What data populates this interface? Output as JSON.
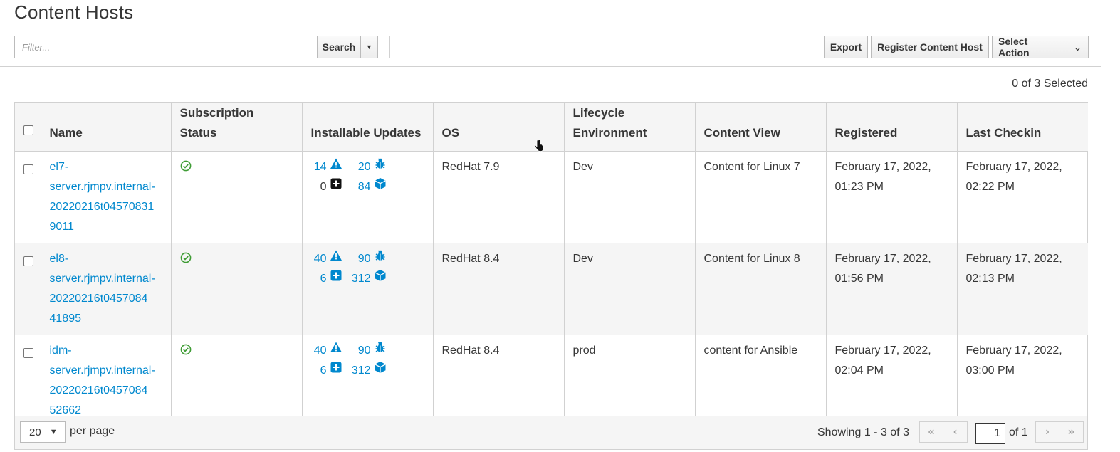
{
  "page": {
    "title": "Content Hosts"
  },
  "toolbar": {
    "filter_placeholder": "Filter...",
    "search_label": "Search",
    "export_label": "Export",
    "register_label": "Register Content Host",
    "select_action_label": "Select Action"
  },
  "selection": {
    "summary": "0 of 3 Selected"
  },
  "table": {
    "columns": [
      "Name",
      "Subscription Status",
      "Installable Updates",
      "OS",
      "Lifecycle Environment",
      "Content View",
      "Registered",
      "Last Checkin"
    ],
    "rows": [
      {
        "name": "el7-server.rjmpv.internal-20220216t045708319011",
        "name_lines": [
          "el7-",
          "server.rjmpv.internal-",
          "20220216t04570831",
          "9011"
        ],
        "subscription_status": "check-circle-icon",
        "security": "14",
        "bugfix": "20",
        "enhancement": "0",
        "packages": "84",
        "os": "RedHat 7.9",
        "lifecycle": "Dev",
        "content_view": "Content for Linux 7",
        "registered": [
          "February 17, 2022,",
          "01:23 PM"
        ],
        "last_checkin": [
          "February 17, 2022,",
          "02:22 PM"
        ]
      },
      {
        "name": "el8-server.rjmpv.internal-2022021 6t045708441895",
        "name_lines": [
          "el8-",
          "server.rjmpv.internal-",
          "20220216t0457084",
          "41895"
        ],
        "subscription_status": "check-circle-icon",
        "security": "40",
        "bugfix": "90",
        "enhancement": "6",
        "packages": "312",
        "os": "RedHat 8.4",
        "lifecycle": "Dev",
        "content_view": "Content for Linux 8",
        "registered": [
          "February 17, 2022,",
          "01:56 PM"
        ],
        "last_checkin": [
          "February 17, 2022,",
          "02:13 PM"
        ]
      },
      {
        "name": "idm-server.rjmpv.internal-20220216t045708452662",
        "name_lines": [
          "idm-",
          "server.rjmpv.internal-",
          "20220216t0457084",
          "52662"
        ],
        "subscription_status": "check-circle-icon",
        "security": "40",
        "bugfix": "90",
        "enhancement": "6",
        "packages": "312",
        "os": "RedHat 8.4",
        "lifecycle": "prod",
        "content_view": "content for Ansible",
        "registered": [
          "February 17, 2022,",
          "02:04 PM"
        ],
        "last_checkin": [
          "February 17, 2022,",
          "03:00 PM"
        ]
      }
    ]
  },
  "pagination": {
    "per_page_value": "20",
    "per_page_label": "per page",
    "showing": "Showing 1 - 3 of 3",
    "current_page": "1",
    "of_pages": "of 1"
  },
  "colors": {
    "link": "#0088ce",
    "success": "#3f9c35",
    "text": "#363636",
    "stripe": "#f5f5f5"
  }
}
